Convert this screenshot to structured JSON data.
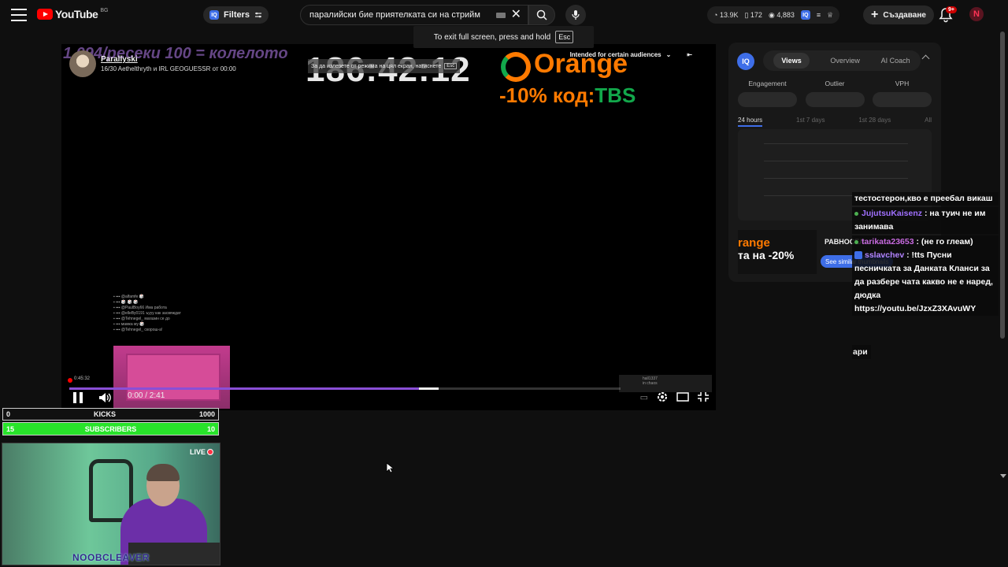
{
  "app": {
    "brand": "YouTube",
    "country": "BG"
  },
  "header": {
    "filters_label": "Filters",
    "iq_label": "IQ",
    "search_value": "паралийски бие приятелката си на стрийм",
    "stats": {
      "views": "13.9K",
      "likes": "172",
      "views2": "4,883"
    },
    "create_label": "Създаване",
    "notifications": "9+",
    "avatar_letter": "N"
  },
  "toast": {
    "text": "To exit full screen, press and hold",
    "key": "Esc"
  },
  "player": {
    "overlay_title": "1 094/ресеки 100 = колелото",
    "overlay_time": "186:42:12",
    "brand": "Orange",
    "promo": "-10% код:",
    "promo_code": "TBS",
    "channel_name": "Parallyski",
    "channel_sub": "16/30 Aethelthryth и IRL GEOGUESSR от 00:00",
    "fs_hint": "За да излезете от режима на цял екран, натиснете",
    "fs_key": "Esc",
    "audience": "Intended for certain audiences",
    "mini_time": "0:45:32",
    "current_time": "0:00 / 2:41",
    "progress_fraction": 0.776,
    "watched_fraction": 0.746
  },
  "panel": {
    "iq": "IQ",
    "tabs": [
      "Views",
      "Overview",
      "AI Coach"
    ],
    "metrics": [
      "Engagement",
      "Outlier",
      "VPH"
    ],
    "ranges": [
      "24 hours",
      "1st 7 days",
      "1st 28 days",
      "All"
    ],
    "similar_title": "РАВНОСЕЛ...",
    "similar_button": "See similar thumbnails",
    "thumb_line1": "range",
    "thumb_line2": "та на -20%"
  },
  "chat": [
    {
      "user": "",
      "text": "тестостерон,кво е преебал викаш"
    },
    {
      "user": "JujutsuKaisenz",
      "text": " : на туич не им занимава"
    },
    {
      "user": "tarikata23653",
      "text": " : (не го глеам)"
    },
    {
      "user": "sslavchev",
      "text": " : !tts Пусни песничката за Данката Кланси за да разбере чата какво не е наред, дюдка https://youtu.be/JzxZ3XAvuWY"
    }
  ],
  "chat_tail": "ари",
  "widgets": {
    "kicks_left": "0",
    "kicks_label": "KICKS",
    "kicks_right": "1000",
    "subs_left": "15",
    "subs_label": "SUBSCRIBERS",
    "subs_right": "10",
    "subs_fraction": 1.0,
    "live_label": "LIVE",
    "cam_name": "NOOBCLEAVER"
  }
}
